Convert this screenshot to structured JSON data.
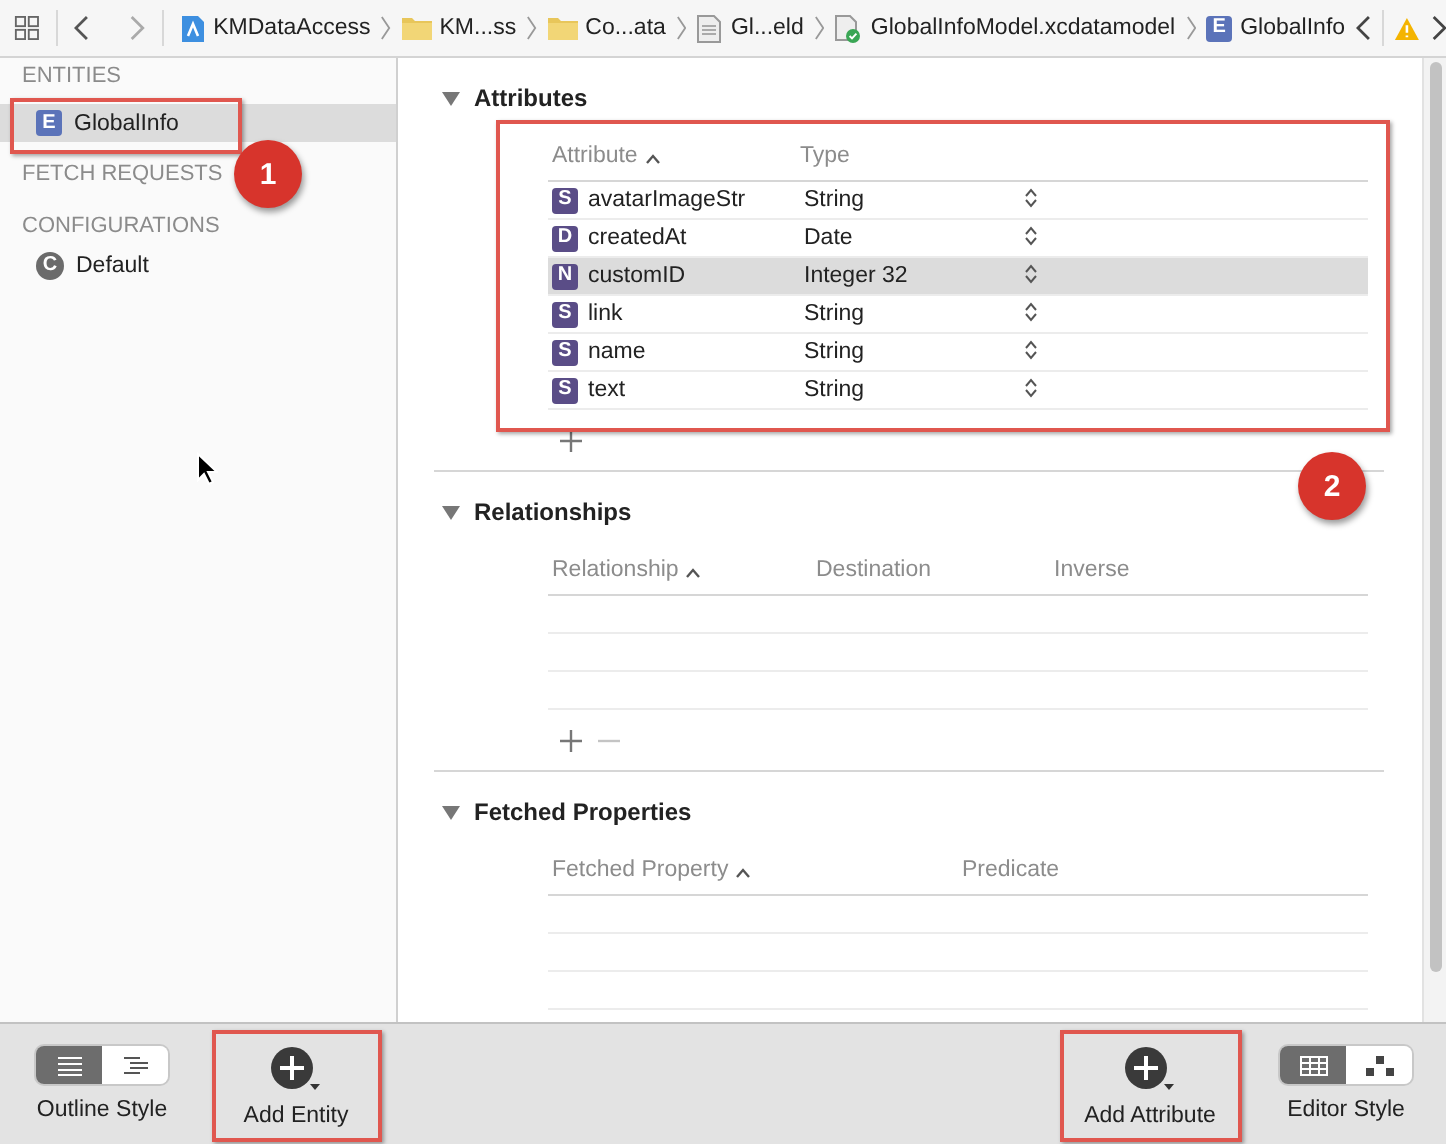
{
  "toolbar": {
    "breadcrumbs": [
      {
        "kind": "project",
        "label": "KMDataAccess"
      },
      {
        "kind": "folder",
        "label": "KM...ss"
      },
      {
        "kind": "folder",
        "label": "Co...ata"
      },
      {
        "kind": "file",
        "label": "Gl...eld"
      },
      {
        "kind": "model",
        "label": "GlobalInfoModel.xcdatamodel"
      },
      {
        "kind": "entity",
        "badge": "E",
        "label": "GlobalInfo"
      }
    ]
  },
  "sidebar": {
    "sections": [
      {
        "title": "ENTITIES",
        "items": [
          {
            "kind": "entity",
            "badge": "E",
            "label": "GlobalInfo",
            "selected": true
          }
        ]
      },
      {
        "title": "FETCH REQUESTS"
      },
      {
        "title": "CONFIGURATIONS",
        "items": [
          {
            "kind": "configuration",
            "badge": "C",
            "label": "Default",
            "selected": false
          }
        ]
      }
    ]
  },
  "editor": {
    "sections": [
      {
        "kind": "attributes",
        "title": "Attributes",
        "expanded": true,
        "columns": [
          {
            "label": "Attribute",
            "sorted": true
          },
          {
            "label": "Type",
            "sorted": false
          }
        ],
        "rows": [
          {
            "badge": "S",
            "name": "avatarImageStr",
            "type": "String",
            "selected": false
          },
          {
            "badge": "D",
            "name": "createdAt",
            "type": "Date",
            "selected": false
          },
          {
            "badge": "N",
            "name": "customID",
            "type": "Integer 32",
            "selected": true
          },
          {
            "badge": "S",
            "name": "link",
            "type": "String",
            "selected": false
          },
          {
            "badge": "S",
            "name": "name",
            "type": "String",
            "selected": false
          },
          {
            "badge": "S",
            "name": "text",
            "type": "String",
            "selected": false
          }
        ]
      },
      {
        "kind": "relationships",
        "title": "Relationships",
        "expanded": true,
        "columns": [
          {
            "label": "Relationship",
            "sorted": true
          },
          {
            "label": "Destination",
            "sorted": false
          },
          {
            "label": "Inverse",
            "sorted": false
          }
        ]
      },
      {
        "kind": "fetched",
        "title": "Fetched Properties",
        "expanded": true,
        "columns": [
          {
            "label": "Fetched Property",
            "sorted": true
          },
          {
            "label": "Predicate",
            "sorted": false
          }
        ]
      }
    ]
  },
  "bottom_bar": {
    "outline_style": {
      "label": "Outline Style",
      "options": [
        {
          "kind": "list",
          "selected": true
        },
        {
          "kind": "outline",
          "selected": false
        }
      ]
    },
    "add_entity": {
      "label": "Add Entity"
    },
    "add_attribute": {
      "label": "Add Attribute"
    },
    "editor_style": {
      "label": "Editor Style",
      "options": [
        {
          "kind": "table",
          "selected": true
        },
        {
          "kind": "graph",
          "selected": false
        }
      ]
    }
  },
  "annotations": [
    {
      "label": "1"
    },
    {
      "label": "2"
    }
  ]
}
